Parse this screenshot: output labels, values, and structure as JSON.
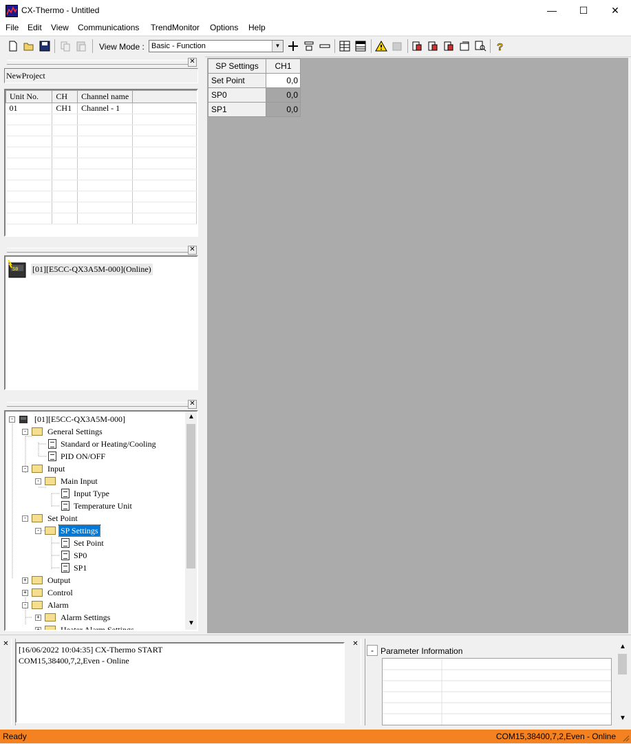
{
  "window": {
    "title": "CX-Thermo - Untitled",
    "minimize": "—",
    "maximize": "☐",
    "close": "✕"
  },
  "menu": [
    "File",
    "Edit",
    "View",
    "Communications",
    "TrendMonitor",
    "Options",
    "Help"
  ],
  "toolbar": {
    "view_mode_label": "View Mode :",
    "view_mode_value": "Basic - Function"
  },
  "project": {
    "name": "NewProject"
  },
  "unit_table": {
    "columns": [
      "Unit No.",
      "CH",
      "Channel name"
    ],
    "rows": [
      [
        "01",
        "CH1",
        "Channel - 1"
      ]
    ]
  },
  "device": {
    "label": "[01][E5CC-QX3A5M-000](Online)"
  },
  "tree": {
    "root": "[01][E5CC-QX3A5M-000]",
    "general_settings": "General Settings",
    "standard_heating": "Standard or Heating/Cooling",
    "pid_onoff": "PID ON/OFF",
    "input": "Input",
    "main_input": "Main Input",
    "input_type": "Input Type",
    "temperature_unit": "Temperature Unit",
    "set_point": "Set Point",
    "sp_settings": "SP Settings",
    "sp_set_point": "Set Point",
    "sp0": "SP0",
    "sp1": "SP1",
    "output": "Output",
    "control": "Control",
    "alarm": "Alarm",
    "alarm_settings": "Alarm Settings",
    "heater_alarm_settings": "Heater Alarm Settings"
  },
  "sp_grid": {
    "header": "SP Settings",
    "channel": "CH1",
    "rows": [
      {
        "name": "Set Point",
        "value": "0,0"
      },
      {
        "name": "SP0",
        "value": "0,0"
      },
      {
        "name": "SP1",
        "value": "0,0"
      }
    ]
  },
  "log": {
    "lines": [
      "[16/06/2022 10:04:35] CX-Thermo START",
      "COM15,38400,7,2,Even - Online"
    ]
  },
  "param_info": {
    "collapse": "-",
    "title": "Parameter Information"
  },
  "status": {
    "left": "Ready",
    "right": "COM15,38400,7,2,Even - Online"
  },
  "colors": {
    "status_bar": "#f58220",
    "selection": "#0078d7",
    "grid_background": "#ababab"
  }
}
